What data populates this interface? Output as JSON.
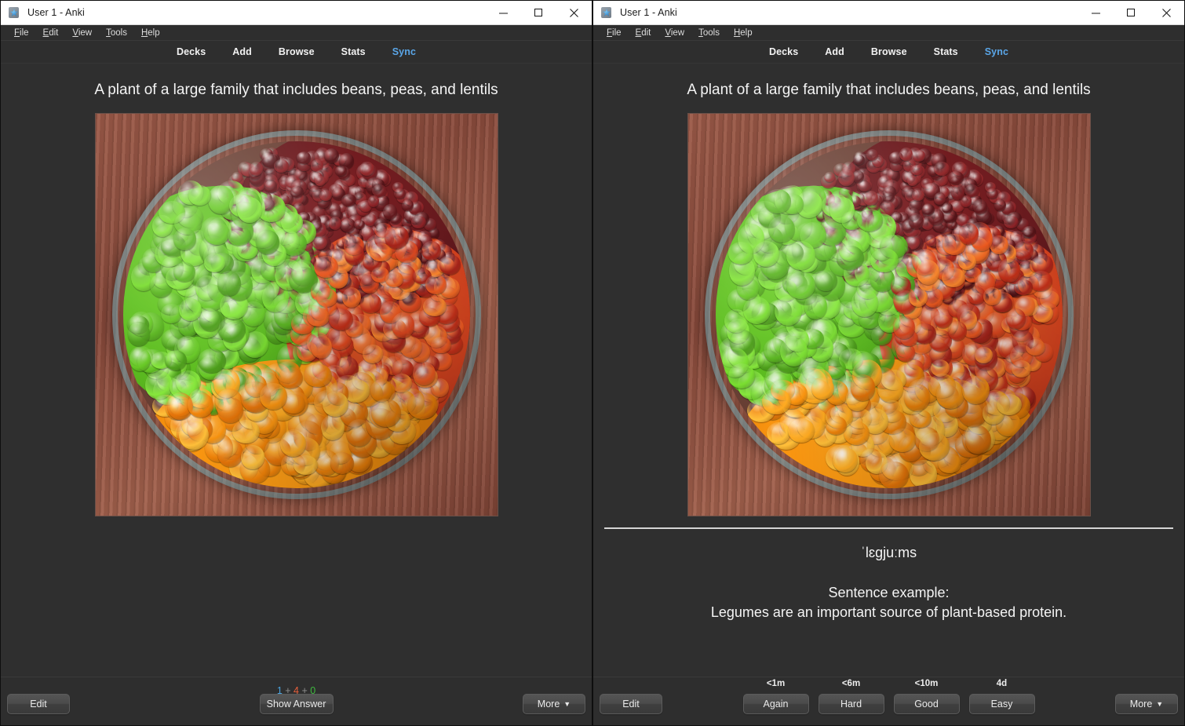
{
  "window": {
    "title": "User 1 - Anki",
    "icon": "anki-card-star-icon",
    "controls": {
      "minimize": "minimize-icon",
      "maximize": "maximize-icon",
      "close": "close-icon"
    }
  },
  "menubar": {
    "items": [
      {
        "label": "File",
        "accel": "F",
        "rest": "ile"
      },
      {
        "label": "Edit",
        "accel": "E",
        "rest": "dit"
      },
      {
        "label": "View",
        "accel": "V",
        "rest": "iew"
      },
      {
        "label": "Tools",
        "accel": "T",
        "rest": "ools"
      },
      {
        "label": "Help",
        "accel": "H",
        "rest": "elp"
      }
    ]
  },
  "navbar": {
    "items": [
      {
        "label": "Decks",
        "active": false
      },
      {
        "label": "Add",
        "active": false
      },
      {
        "label": "Browse",
        "active": false
      },
      {
        "label": "Stats",
        "active": false
      },
      {
        "label": "Sync",
        "active": true
      }
    ],
    "active_color": "#5aa6e8"
  },
  "card": {
    "question": "A plant of a large family that includes beans, peas, and lentils",
    "image_alt": "Glass bowl of four colored legume varieties on a wooden table",
    "ipa": "ˈlɛɡjuːms",
    "answer_heading": "Sentence example:",
    "answer_sentence": "Legumes are an important source of plant-based protein."
  },
  "front_bottom": {
    "edit_label": "Edit",
    "show_answer_label": "Show Answer",
    "more_label": "More",
    "more_caret": "▼",
    "counts": {
      "new": "1",
      "learning": "4",
      "review": "0",
      "separator": "+",
      "new_color": "#4aa3df",
      "learning_color": "#e8603c",
      "review_color": "#3fbb3f"
    }
  },
  "back_bottom": {
    "edit_label": "Edit",
    "more_label": "More",
    "more_caret": "▼",
    "ease_buttons": [
      {
        "interval": "<1m",
        "label": "Again"
      },
      {
        "interval": "<6m",
        "label": "Hard"
      },
      {
        "interval": "<10m",
        "label": "Good"
      },
      {
        "interval": "4d",
        "label": "Easy"
      }
    ]
  },
  "theme": {
    "window_bg": "#2e2e2e",
    "card_bg": "#2f2f2f",
    "text": "#f4f4f4",
    "titlebar_bg": "#ffffff",
    "titlebar_text": "#1a1a1a"
  }
}
